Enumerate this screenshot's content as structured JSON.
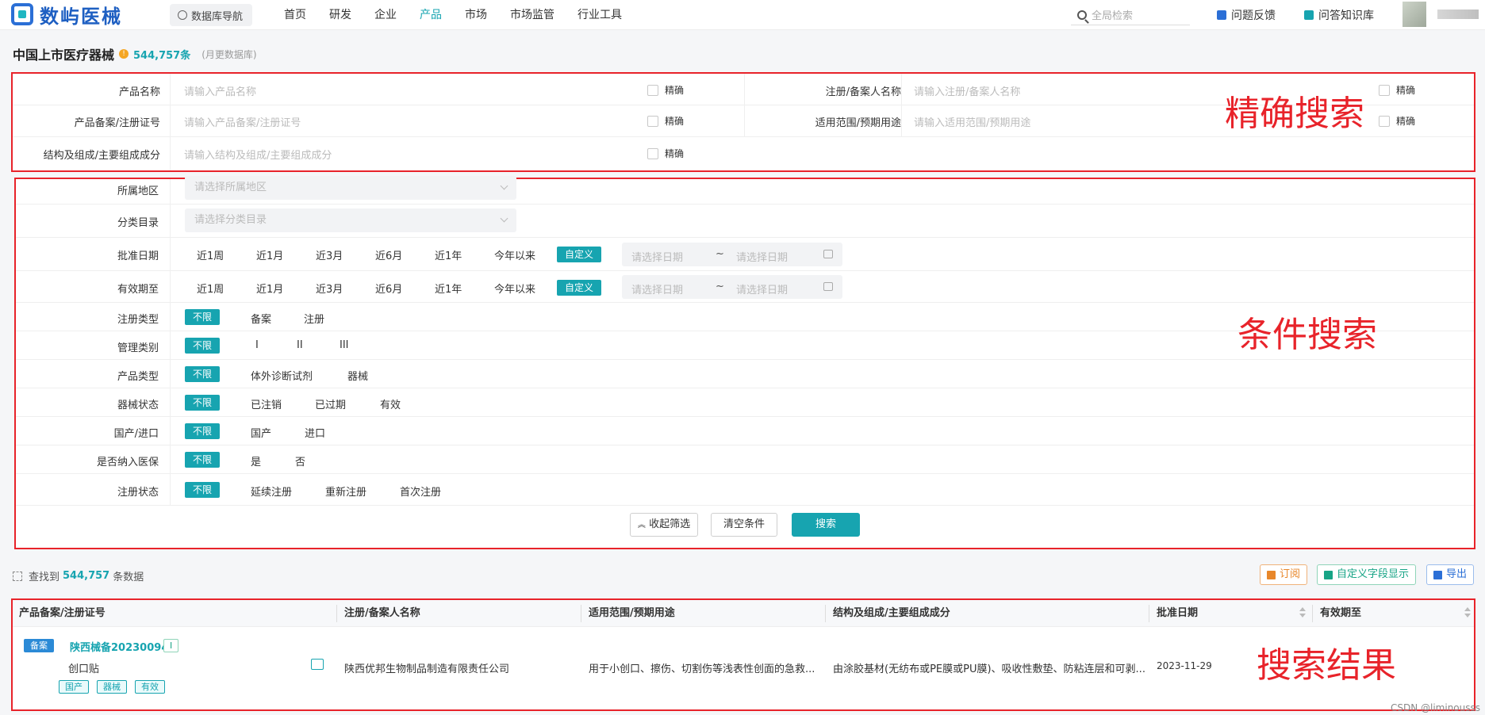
{
  "header": {
    "brand": "数屿医械",
    "db_nav": "数据库导航",
    "nav": [
      "首页",
      "研发",
      "企业",
      "产品",
      "市场",
      "市场监管",
      "行业工具"
    ],
    "active_nav": "产品",
    "search_placeholder": "全局检索",
    "feedback": "问题反馈",
    "kb": "问答知识库"
  },
  "page": {
    "title": "中国上市医疗器械",
    "count": "544,757条",
    "note": "(月更数据库)"
  },
  "exact_search": {
    "overlay": "精确搜索",
    "fields": [
      {
        "label": "产品名称",
        "placeholder": "请输入产品名称",
        "check": "精确"
      },
      {
        "label": "注册/备案人名称",
        "placeholder": "请输入注册/备案人名称",
        "check": "精确"
      },
      {
        "label": "产品备案/注册证号",
        "placeholder": "请输入产品备案/注册证号",
        "check": "精确"
      },
      {
        "label": "适用范围/预期用途",
        "placeholder": "请输入适用范围/预期用途",
        "check": "精确"
      },
      {
        "label": "结构及组成/主要组成成分",
        "placeholder": "请输入结构及组成/主要组成成分",
        "check": "精确"
      }
    ]
  },
  "cond_search": {
    "overlay": "条件搜索",
    "region": {
      "label": "所属地区",
      "placeholder": "请选择所属地区"
    },
    "category": {
      "label": "分类目录",
      "placeholder": "请选择分类目录"
    },
    "approval_date": {
      "label": "批准日期"
    },
    "valid_until": {
      "label": "有效期至"
    },
    "periods": [
      "近1周",
      "近1月",
      "近3月",
      "近6月",
      "近1年",
      "今年以来",
      "自定义"
    ],
    "date_placeholder": "请选择日期",
    "date_sep": "~",
    "filters": [
      {
        "label": "注册类型",
        "options": [
          "不限",
          "备案",
          "注册"
        ]
      },
      {
        "label": "管理类别",
        "options": [
          "不限",
          "I",
          "II",
          "III"
        ]
      },
      {
        "label": "产品类型",
        "options": [
          "不限",
          "体外诊断试剂",
          "器械"
        ]
      },
      {
        "label": "器械状态",
        "options": [
          "不限",
          "已注销",
          "已过期",
          "有效"
        ]
      },
      {
        "label": "国产/进口",
        "options": [
          "不限",
          "国产",
          "进口"
        ]
      },
      {
        "label": "是否纳入医保",
        "options": [
          "不限",
          "是",
          "否"
        ]
      },
      {
        "label": "注册状态",
        "options": [
          "不限",
          "延续注册",
          "重新注册",
          "首次注册"
        ]
      }
    ],
    "buttons": {
      "collapse": "收起筛选",
      "clear": "清空条件",
      "search": "搜索"
    }
  },
  "results": {
    "overlay": "搜索结果",
    "found_prefix": "查找到",
    "found_count": "544,757",
    "found_suffix": "条数据",
    "tools": {
      "subscribe": "订阅",
      "custom": "自定义字段显示",
      "export": "导出"
    },
    "columns": [
      "产品备案/注册证号",
      "注册/备案人名称",
      "适用范围/预期用途",
      "结构及组成/主要组成成分",
      "批准日期",
      "有效期至"
    ],
    "row": {
      "badge": "备案",
      "code": "陕西械备20230094",
      "class": "I",
      "name": "创口贴",
      "company": "陕西优邦生物制品制造有限责任公司",
      "scope": "用于小创口、擦伤、切割伤等浅表性创面的急救...",
      "structure": "由涂胶基材(无纺布或PE膜或PU膜)、吸收性敷垫、防粘连层和可剥...",
      "date": "2023-11-29",
      "tags": [
        "国产",
        "器械",
        "有效"
      ]
    }
  },
  "watermark": "CSDN @liminousss",
  "colors": {
    "accent": "#17a4b0",
    "brand": "#1e5fc2",
    "annotation": "#e8232a"
  }
}
